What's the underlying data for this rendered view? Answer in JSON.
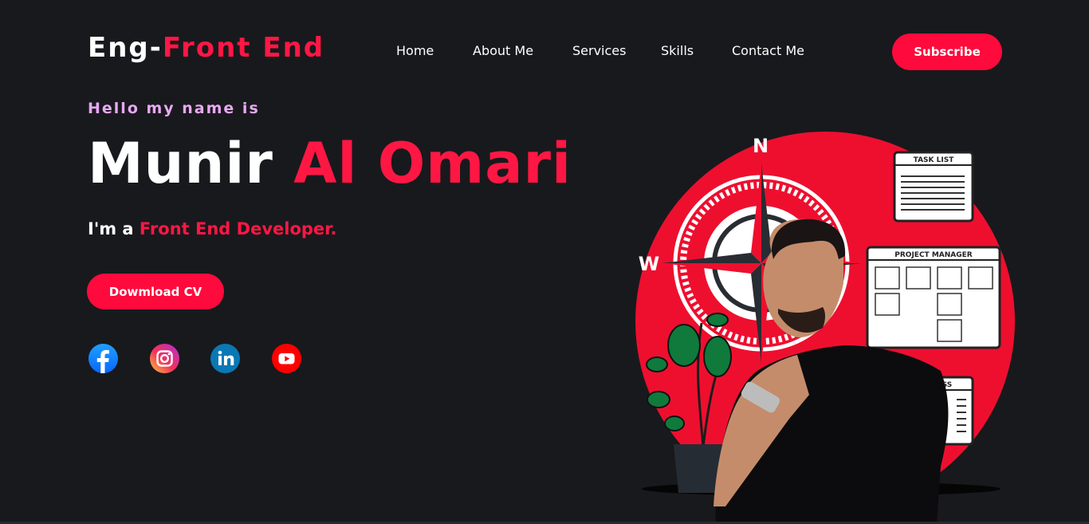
{
  "brand": {
    "part1": "Eng-",
    "part2": "Front End"
  },
  "nav": {
    "items": [
      "Home",
      "About Me",
      "Services",
      "Skills",
      "Contact Me"
    ]
  },
  "header": {
    "subscribe_label": "Subscribe"
  },
  "hero": {
    "greeting": "Hello my name is",
    "first_name": "Munir",
    "last_name": "Al Omari",
    "role_prefix": "I'm a",
    "role": "Front End Developer.",
    "cv_label": "Dowmload CV"
  },
  "social": {
    "icons": [
      "facebook-icon",
      "instagram-icon",
      "linkedin-icon",
      "youtube-icon"
    ]
  },
  "illustration": {
    "compass_labels": [
      "N",
      "W"
    ],
    "cards": [
      "TASK LIST",
      "PROJECT MANAGER",
      "SS"
    ]
  },
  "colors": {
    "background": "#18191d",
    "accent": "#ff0a3c",
    "greeting": "#e9a8f5"
  }
}
